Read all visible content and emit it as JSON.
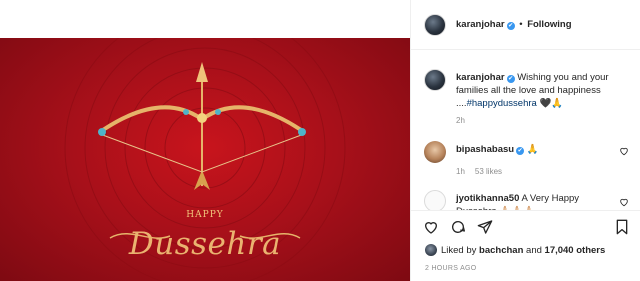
{
  "post": {
    "image": {
      "small_text": "HAPPY",
      "title": "Dussehra",
      "colors": {
        "background": "#b2121c",
        "gold": "#eab370"
      }
    },
    "author": {
      "username": "karanjohar",
      "verified_icon": "✔",
      "separator": "•",
      "follow_status": "Following"
    },
    "caption": {
      "username": "karanjohar",
      "text": "Wishing you and your families all the love and happiness ....",
      "hashtag": "#happydussehra",
      "emoji": "🖤🙏",
      "time": "2h"
    },
    "comments": [
      {
        "username": "bipashabasu",
        "text": "🙏",
        "time": "1h",
        "likes": "53 likes"
      },
      {
        "username": "jyotikhanna50",
        "text": "A Very Happy Dussehra 🙏🏻🙏🏻🙏🏻"
      }
    ],
    "likes_text": {
      "prefix": "Liked by",
      "user": "bachchan",
      "middle": "and",
      "count": "17,040 others"
    },
    "timestamp": "2 HOURS AGO"
  }
}
